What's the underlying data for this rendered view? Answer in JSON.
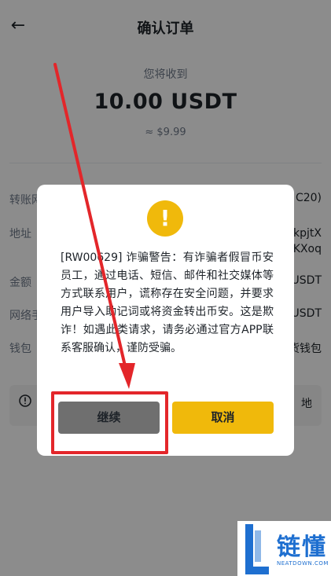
{
  "header": {
    "back_icon": "arrow-left-icon",
    "title": "确认订单"
  },
  "summary": {
    "caption": "您将收到",
    "amount": "10.00 USDT",
    "usd_value": "≈ $9.99"
  },
  "details": [
    {
      "label": "转账网",
      "value": "C20)"
    },
    {
      "label": "地址",
      "value_line1": "kpjtX",
      "value_line2": "KXoq"
    },
    {
      "label": "金额",
      "value": "USDT"
    },
    {
      "label": "网络手",
      "value": "USDT"
    },
    {
      "label": "钱包",
      "value": "货钱包"
    }
  ],
  "notice": {
    "icon": "info-icon",
    "text": "地"
  },
  "modal": {
    "icon": "exclamation-icon",
    "message": "[RW00629] 诈骗警告：有诈骗者假冒币安员工，通过电话、短信、邮件和社交媒体等方式联系用户，谎称存在安全问题，并要求用户导入助记词或将资金转出币安。这是欺诈！如遇此类请求，请务必通过官方APP联系客服确认，谨防受骗。",
    "continue_label": "继续",
    "cancel_label": "取消"
  },
  "watermark": {
    "brand": "链懂",
    "site": "NEATDOWN.COM"
  },
  "colors": {
    "accent": "#f0b90b",
    "annotation": "#e3262a",
    "watermark": "#1e6fd0"
  }
}
